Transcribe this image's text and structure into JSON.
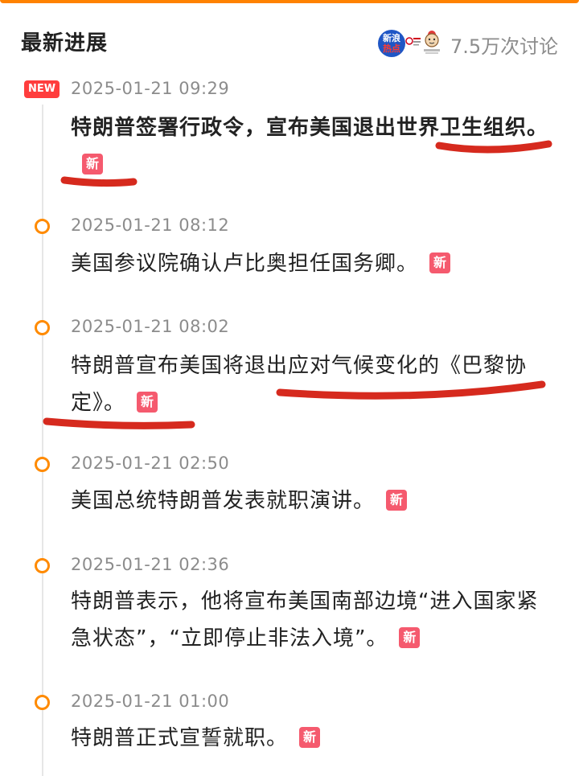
{
  "header": {
    "title": "最新进展",
    "hot_logo_line1": "新浪",
    "hot_logo_line2": "热点",
    "discussion_count": "7.5万次讨论"
  },
  "timeline": [
    {
      "new": true,
      "new_label": "NEW",
      "time": "2025-01-21 09:29",
      "text": "特朗普签署行政令，宣布美国退出世界卫生组织。",
      "tag": "新",
      "bold": true
    },
    {
      "new": false,
      "time": "2025-01-21 08:12",
      "text": "美国参议院确认卢比奥担任国务卿。",
      "tag": "新"
    },
    {
      "new": false,
      "time": "2025-01-21 08:02",
      "text": "特朗普宣布美国将退出应对气候变化的《巴黎协定》。",
      "tag": "新"
    },
    {
      "new": false,
      "time": "2025-01-21 02:50",
      "text": "美国总统特朗普发表就职演讲。",
      "tag": "新"
    },
    {
      "new": false,
      "time": "2025-01-21 02:36",
      "text": "特朗普表示，他将宣布美国南部边境“进入国家紧急状态”，“立即停止非法入境”。",
      "tag": "新"
    },
    {
      "new": false,
      "time": "2025-01-21 01:00",
      "text": "特朗普正式宣誓就职。",
      "tag": "新"
    }
  ],
  "colors": {
    "accent": "#ff8a00",
    "new_badge": "#ff3d3d",
    "tag": "#f55a6e",
    "annotation": "#d62a1e"
  }
}
